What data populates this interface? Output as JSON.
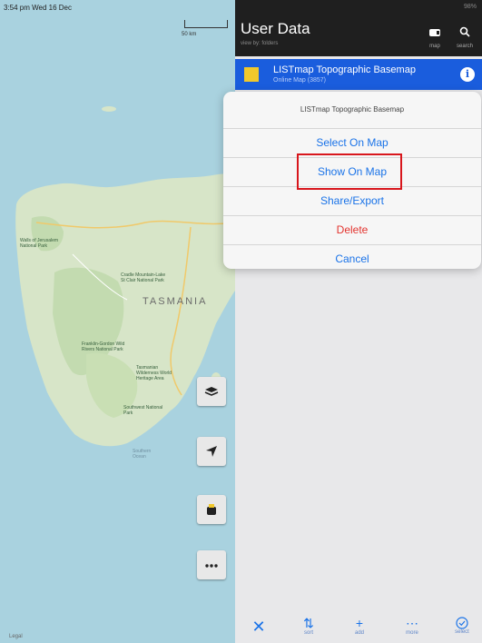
{
  "status": {
    "time_date": "3:54 pm  Wed 16 Dec",
    "battery": "98%"
  },
  "map": {
    "scale_label": "50 km",
    "region_label": "TASMANIA",
    "place_labels": [
      "Walls of Jerusalem National Park",
      "Cradle Mountain-Lake St Clair National Park",
      "Tasmanian Wilderness World Heritage Area",
      "Franklin-Gordon Wild Rivers National Park",
      "Southwest National Park",
      "Southern Ocean"
    ],
    "legal": "Legal"
  },
  "panel": {
    "title": "User Data",
    "subtitle": "view by: folders",
    "header_buttons": [
      {
        "label": "map"
      },
      {
        "label": "search"
      }
    ],
    "selected_item": {
      "title": "LISTmap Topographic Basemap",
      "subtitle": "Online Map (3857)"
    }
  },
  "action_sheet": {
    "title": "LISTmap Topographic Basemap",
    "items": [
      {
        "label": "Select On Map"
      },
      {
        "label": "Show On Map"
      },
      {
        "label": "Share/Export"
      },
      {
        "label": "Delete"
      },
      {
        "label": "Cancel"
      }
    ]
  },
  "toolbar": {
    "items": [
      {
        "label": ""
      },
      {
        "label": "sort"
      },
      {
        "label": "add"
      },
      {
        "label": "more"
      },
      {
        "label": "select"
      }
    ]
  },
  "colors": {
    "accent": "#1a73e8",
    "selected_row": "#1a5ddd",
    "destructive": "#e3342f",
    "highlight": "#d8161c"
  }
}
